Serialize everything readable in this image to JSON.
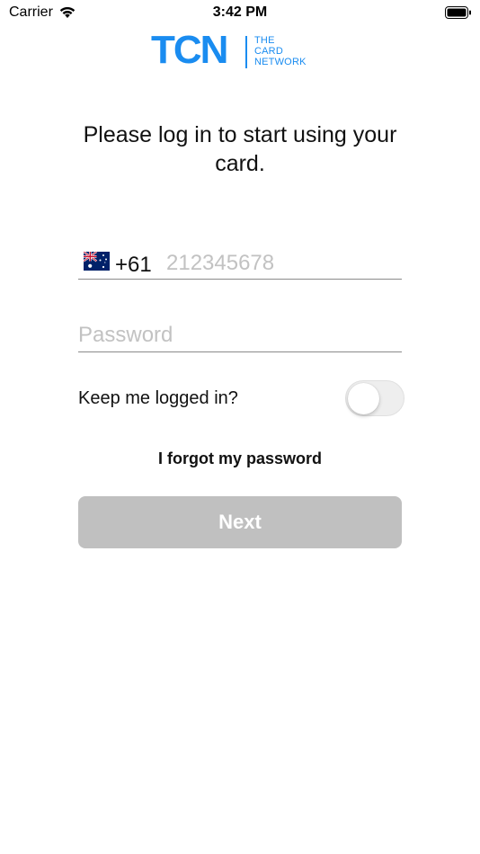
{
  "status_bar": {
    "carrier": "Carrier",
    "time": "3:42 PM",
    "wifi_icon": "wifi-icon",
    "battery_icon": "battery-full-icon"
  },
  "logo": {
    "mark": "TCN",
    "line1": "THE",
    "line2": "CARD",
    "line3": "NETWORK",
    "color": "#1a8cf0"
  },
  "login": {
    "heading": "Please log in to start using your card.",
    "phone": {
      "flag_icon": "australia-flag-icon",
      "country_code": "+61",
      "placeholder": "212345678",
      "value": ""
    },
    "password": {
      "placeholder": "Password",
      "value": ""
    },
    "keep_logged_in": {
      "label": "Keep me logged in?",
      "checked": false
    },
    "forgot_password": "I forgot my password",
    "next_button": "Next",
    "next_disabled_color": "#c0c0c0"
  }
}
